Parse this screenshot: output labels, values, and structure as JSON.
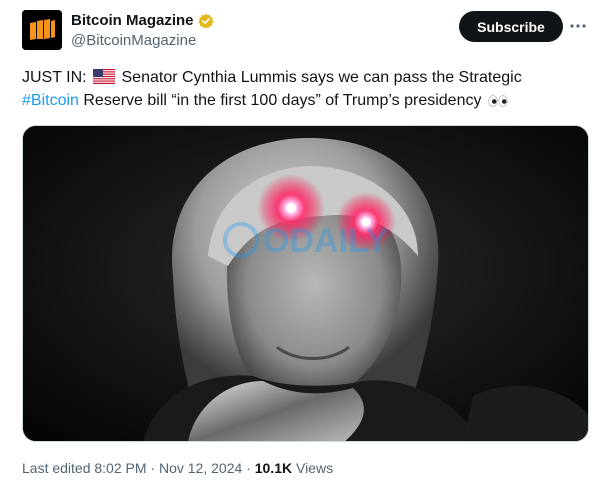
{
  "author": {
    "display_name": "Bitcoin Magazine",
    "handle": "@BitcoinMagazine",
    "avatar_icon": "bitcoin-magazine-logo",
    "verified_icon": "gold-verified-badge-icon",
    "verified_color": "#e2b719"
  },
  "actions": {
    "subscribe_label": "Subscribe",
    "more_icon": "more-horizontal-icon"
  },
  "tweet": {
    "prefix": "JUST IN:",
    "flag_icon": "us-flag-icon",
    "text_part1": " Senator Cynthia Lummis says we can pass the Strategic ",
    "hashtag": "#Bitcoin",
    "text_part2": " Reserve bill “in the first 100 days” of Trump’s presidency",
    "emoji_icon": "eyes-icon"
  },
  "media": {
    "description_icon": "photo-senator-laser-eyes",
    "watermark": "ODAILY"
  },
  "meta": {
    "edited": "Last edited 8:02 PM",
    "separator1": "·",
    "date": "Nov 12, 2024",
    "separator2": "·",
    "views_count": "10.1K",
    "views_label": "Views"
  },
  "colors": {
    "hashtag": "#1d9bf0",
    "text": "#0f1419",
    "muted": "#536471",
    "laser": "#ff2a6a"
  }
}
